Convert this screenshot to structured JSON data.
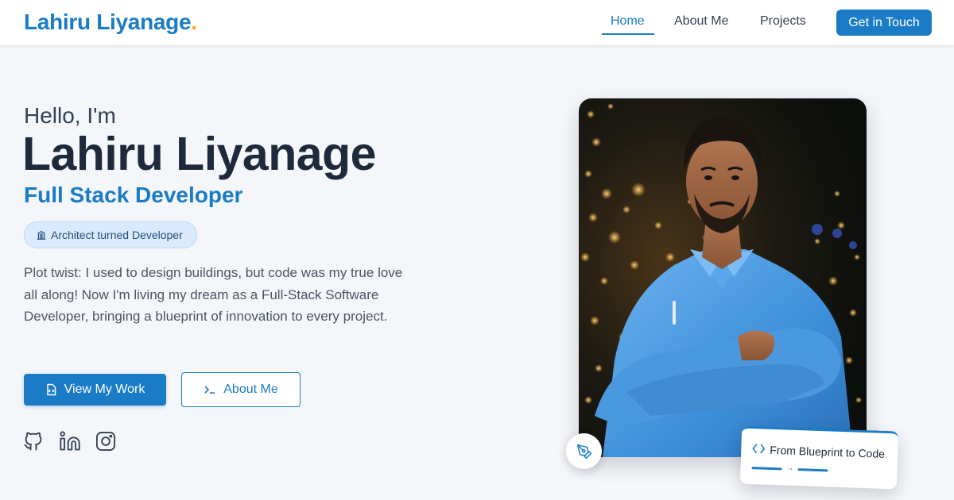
{
  "header": {
    "logo_text": "Lahiru Liyanage",
    "logo_dot": ".",
    "nav": {
      "home": "Home",
      "about": "About Me",
      "projects": "Projects"
    },
    "cta_label": "Get in Touch"
  },
  "hero": {
    "greeting": "Hello, I'm",
    "name": "Lahiru Liyanage",
    "role": "Full Stack Developer",
    "badge": "Architect turned Developer",
    "bio": "Plot twist: I used to design buildings, but code was my true love all along! Now I'm living my dream as a Full-Stack Software Developer, bringing a blueprint of innovation to every project.",
    "primary_button": "View My Work",
    "secondary_button": "About Me",
    "social_icons": [
      "github-icon",
      "linkedin-icon",
      "instagram-icon"
    ]
  },
  "photo_card": {
    "tagline": "From Blueprint to Code",
    "arrow": "→",
    "pen_icon": "pen-tool-icon"
  },
  "colors": {
    "accent": "#1a7cc7",
    "logo_dot": "#f5a623",
    "background": "#f4f6f9",
    "badge_bg": "#dbeafe"
  }
}
